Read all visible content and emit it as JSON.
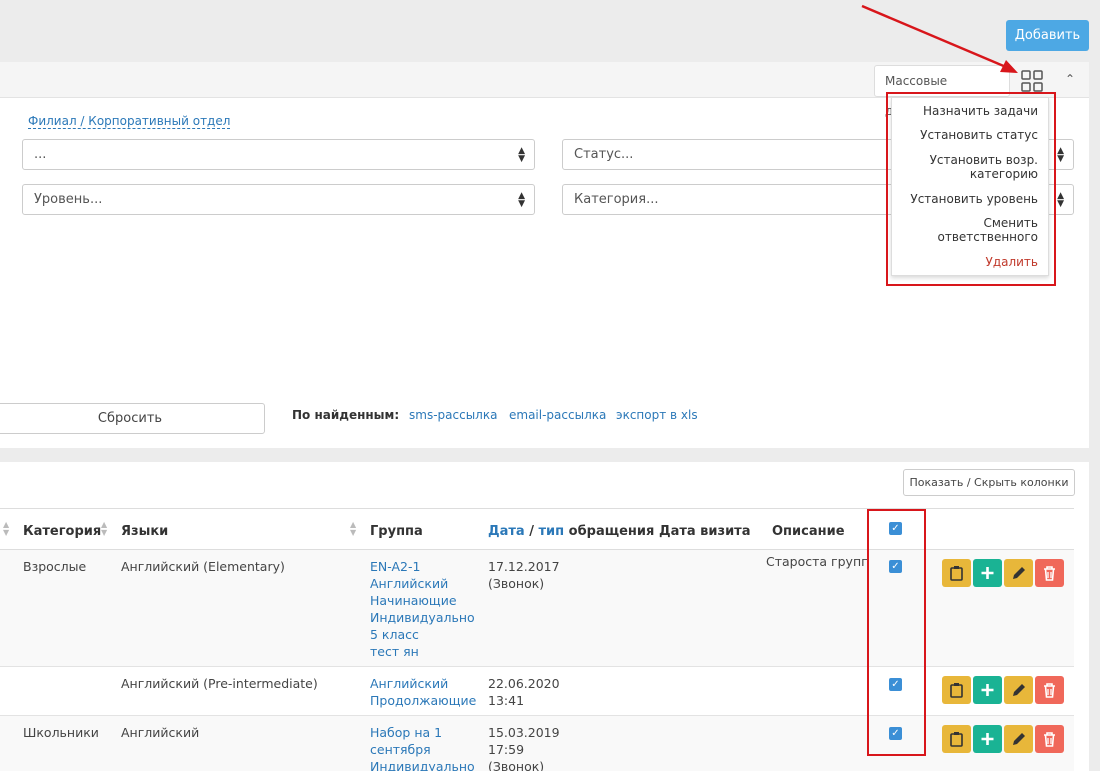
{
  "toolbar": {
    "add_label": "Добавить"
  },
  "filter": {
    "mass_actions_label": "Массовые действия",
    "branch_label": "Филиал / Корпоративный отдел",
    "branch_select": "...",
    "status_select": "Статус...",
    "level_select": "Уровень...",
    "category_select": "Категория...",
    "reset_label": "Сбросить",
    "found_label": "По найденным:",
    "found_links": [
      "sms-рассылка",
      "email-рассылка",
      "экспорт в xls"
    ]
  },
  "mass_menu": {
    "items": [
      "Назначить задачи",
      "Установить статус",
      "Установить возр. категорию",
      "Установить уровень",
      "Сменить ответственного",
      "Удалить"
    ]
  },
  "table": {
    "toggle_columns_label": "Показать / Скрыть колонки",
    "headers": {
      "category": "Категория",
      "languages": "Языки",
      "group": "Группа",
      "date_prefix": "Дата",
      "date_sep": " / ",
      "date_type": "тип",
      "date_suffix": " обращения",
      "visit_date": "Дата визита",
      "description": "Описание"
    },
    "rows": [
      {
        "category": "Взрослые",
        "languages": "Английский (Elementary)",
        "group": [
          "EN-A2-1",
          "Английский",
          "Начинающие",
          "Индивидуально",
          "5 класс",
          "тест ян"
        ],
        "date": [
          "17.12.2017",
          "(Звонок)"
        ],
        "description": "Староста групп"
      },
      {
        "category": "",
        "languages": "Английский (Pre-intermediate)",
        "group": [
          "Английский",
          "Продолжающие"
        ],
        "date": [
          "22.06.2020",
          "13:41"
        ],
        "description": ""
      },
      {
        "category": "Школьники",
        "languages": "Английский",
        "group": [
          "Набор на 1",
          "сентября",
          "Индивидуально"
        ],
        "date": [
          "15.03.2019",
          "17:59",
          "(Звонок)"
        ],
        "description": ""
      }
    ]
  },
  "colors": {
    "accent": "#4da8e4",
    "link": "#2b78b8",
    "highlight": "#d8161b",
    "danger_text": "#c0392b"
  },
  "icons": [
    "grid-icon",
    "chevron-up-icon",
    "clipboard-icon",
    "plus-icon",
    "pencil-icon",
    "trash-icon",
    "checkbox-icon",
    "sort-icon"
  ]
}
